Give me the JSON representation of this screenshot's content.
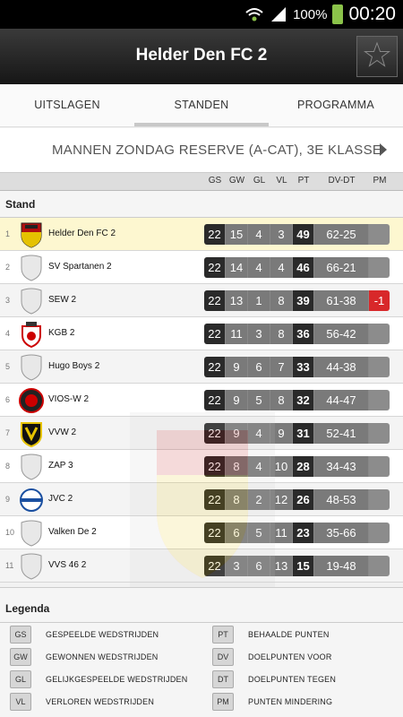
{
  "status_bar": {
    "battery_percent": "100%",
    "time": "00:20"
  },
  "header": {
    "title": "Helder Den FC 2",
    "favorite_icon": "star-icon"
  },
  "tabs": [
    {
      "label": "UITSLAGEN",
      "active": false
    },
    {
      "label": "STANDEN",
      "active": true
    },
    {
      "label": "PROGRAMMA",
      "active": false
    }
  ],
  "competition": {
    "label": "MANNEN ZONDAG RESERVE (A-CAT), 3E KLASSE"
  },
  "columns": [
    "GS",
    "GW",
    "GL",
    "VL",
    "PT",
    "DV-DT",
    "PM"
  ],
  "section_title": "Stand",
  "standings": [
    {
      "pos": "1",
      "team": "Helder Den FC 2",
      "gs": "22",
      "gw": "15",
      "gl": "4",
      "vl": "3",
      "pt": "49",
      "dvdt": "62-25",
      "pm": "",
      "crest": "helder-den-crest",
      "highlight": true
    },
    {
      "pos": "2",
      "team": "SV Spartanen 2",
      "gs": "22",
      "gw": "14",
      "gl": "4",
      "vl": "4",
      "pt": "46",
      "dvdt": "66-21",
      "pm": "",
      "crest": "generic-shield"
    },
    {
      "pos": "3",
      "team": "SEW 2",
      "gs": "22",
      "gw": "13",
      "gl": "1",
      "vl": "8",
      "pt": "39",
      "dvdt": "61-38",
      "pm": "-1",
      "crest": "generic-shield"
    },
    {
      "pos": "4",
      "team": "KGB 2",
      "gs": "22",
      "gw": "11",
      "gl": "3",
      "vl": "8",
      "pt": "36",
      "dvdt": "56-42",
      "pm": "",
      "crest": "kgb-crest"
    },
    {
      "pos": "5",
      "team": "Hugo Boys 2",
      "gs": "22",
      "gw": "9",
      "gl": "6",
      "vl": "7",
      "pt": "33",
      "dvdt": "44-38",
      "pm": "",
      "crest": "generic-shield"
    },
    {
      "pos": "6",
      "team": "VIOS-W 2",
      "gs": "22",
      "gw": "9",
      "gl": "5",
      "vl": "8",
      "pt": "32",
      "dvdt": "44-47",
      "pm": "",
      "crest": "vios-crest"
    },
    {
      "pos": "7",
      "team": "VVW 2",
      "gs": "22",
      "gw": "9",
      "gl": "4",
      "vl": "9",
      "pt": "31",
      "dvdt": "52-41",
      "pm": "",
      "crest": "vvw-crest"
    },
    {
      "pos": "8",
      "team": "ZAP 3",
      "gs": "22",
      "gw": "8",
      "gl": "4",
      "vl": "10",
      "pt": "28",
      "dvdt": "34-43",
      "pm": "",
      "crest": "generic-shield"
    },
    {
      "pos": "9",
      "team": "JVC 2",
      "gs": "22",
      "gw": "8",
      "gl": "2",
      "vl": "12",
      "pt": "26",
      "dvdt": "48-53",
      "pm": "",
      "crest": "jvc-crest"
    },
    {
      "pos": "10",
      "team": "Valken De 2",
      "gs": "22",
      "gw": "6",
      "gl": "5",
      "vl": "11",
      "pt": "23",
      "dvdt": "35-66",
      "pm": "",
      "crest": "generic-shield"
    },
    {
      "pos": "11",
      "team": "VVS 46 2",
      "gs": "22",
      "gw": "3",
      "gl": "6",
      "vl": "13",
      "pt": "15",
      "dvdt": "19-48",
      "pm": "",
      "crest": "generic-shield"
    }
  ],
  "legenda": {
    "title": "Legenda",
    "items": [
      {
        "code": "GS",
        "text": "GESPEELDE WEDSTRIJDEN"
      },
      {
        "code": "GW",
        "text": "GEWONNEN WEDSTRIJDEN"
      },
      {
        "code": "GL",
        "text": "GELIJKGESPEELDE WEDSTRIJDEN"
      },
      {
        "code": "VL",
        "text": "VERLOREN WEDSTRIJDEN"
      },
      {
        "code": "PT",
        "text": "BEHAALDE PUNTEN"
      },
      {
        "code": "DV",
        "text": "DOELPUNTEN VOOR"
      },
      {
        "code": "DT",
        "text": "DOELPUNTEN TEGEN"
      },
      {
        "code": "PM",
        "text": "PUNTEN MINDERING"
      }
    ]
  },
  "colors": {
    "highlight_row": "#fdf7d0",
    "penalty_red": "#d8282a",
    "dark_cell": "#2a2a2a",
    "grey_cell": "#7a7a7a"
  }
}
